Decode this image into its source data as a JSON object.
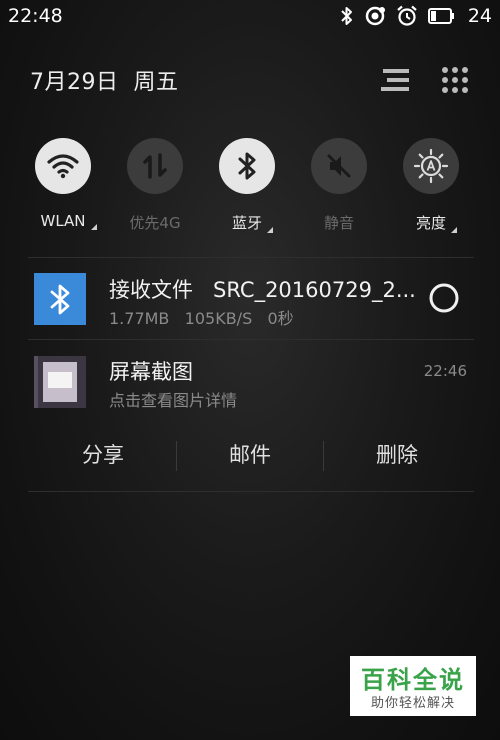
{
  "status_bar": {
    "time": "22:48",
    "battery_level": "24",
    "icons": [
      "bluetooth-icon",
      "data-sync-icon",
      "alarm-icon",
      "battery-icon"
    ]
  },
  "header": {
    "date": "7月29日",
    "weekday": "周五",
    "icons": [
      "list-settings-icon",
      "grid-menu-icon"
    ]
  },
  "quick_toggles": [
    {
      "label": "WLAN",
      "icon": "wifi-icon",
      "active": true,
      "expandable": true
    },
    {
      "label": "优先4G",
      "icon": "mobile-data-icon",
      "active": false,
      "expandable": false
    },
    {
      "label": "蓝牙",
      "icon": "bluetooth-icon",
      "active": true,
      "expandable": true
    },
    {
      "label": "静音",
      "icon": "mute-icon",
      "active": false,
      "expandable": false
    },
    {
      "label": "亮度",
      "icon": "brightness-icon",
      "active": true,
      "expandable": true
    }
  ],
  "notifications": [
    {
      "title": "接收文件",
      "filename": "SRC_20160729_2...",
      "size": "1.77MB",
      "speed": "105KB/S",
      "elapsed": "0秒",
      "icon": "bluetooth-icon",
      "icon_bg": "#3b8ad9"
    },
    {
      "title": "屏幕截图",
      "subtitle": "点击查看图片详情",
      "time": "22:46",
      "icon": "screenshot-thumbnail",
      "actions": [
        "分享",
        "邮件",
        "删除"
      ]
    }
  ],
  "watermark": {
    "title": "百科全说",
    "subtitle": "助你轻松解决",
    "color": "#3aa34a"
  }
}
